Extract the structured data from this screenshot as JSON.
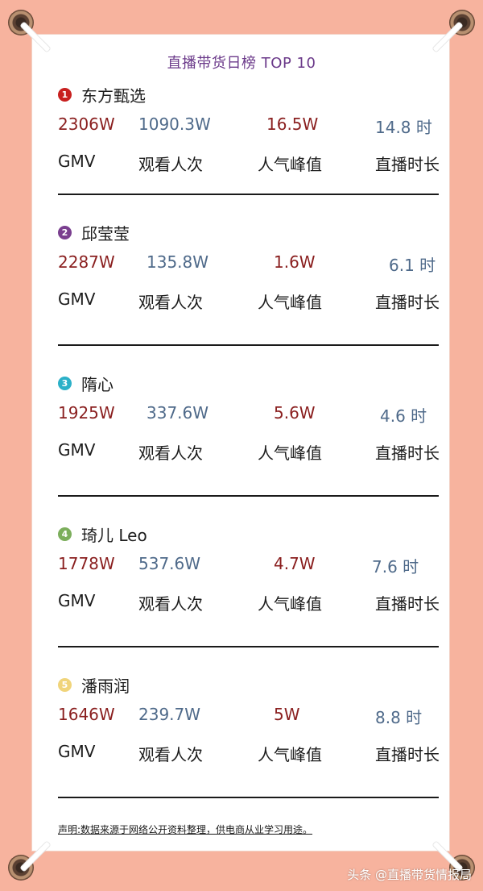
{
  "title": "直播带货日榜 TOP 10",
  "labels": {
    "gmv": "GMV",
    "views": "观看人次",
    "peak": "人气峰值",
    "duration": "直播时长"
  },
  "colors": {
    "badge1": "#c8201f",
    "badge2": "#7a3f8f",
    "badge3": "#2bb0c8",
    "badge4": "#7cae5c",
    "badge5": "#f0d47a"
  },
  "entries": [
    {
      "rank": "1",
      "name": "东方甄选",
      "gmv": "2306W",
      "views": "1090.3W",
      "peak": "16.5W",
      "duration": "14.8 时"
    },
    {
      "rank": "2",
      "name": "邱莹莹",
      "gmv": "2287W",
      "views": "135.8W",
      "peak": "1.6W",
      "duration": "6.1 时"
    },
    {
      "rank": "3",
      "name": "隋心",
      "gmv": "1925W",
      "views": "337.6W",
      "peak": "5.6W",
      "duration": "4.6 时"
    },
    {
      "rank": "4",
      "name": "琦儿 Leo",
      "gmv": "1778W",
      "views": "537.6W",
      "peak": "4.7W",
      "duration": "7.6 时"
    },
    {
      "rank": "5",
      "name": "潘雨润",
      "gmv": "1646W",
      "views": "239.7W",
      "peak": "5W",
      "duration": "8.8 时"
    }
  ],
  "disclaimer": "声明:数据来源于网络公开资料整理，供电商从业学习用途。",
  "credit": "头条 @直播带货情报局"
}
